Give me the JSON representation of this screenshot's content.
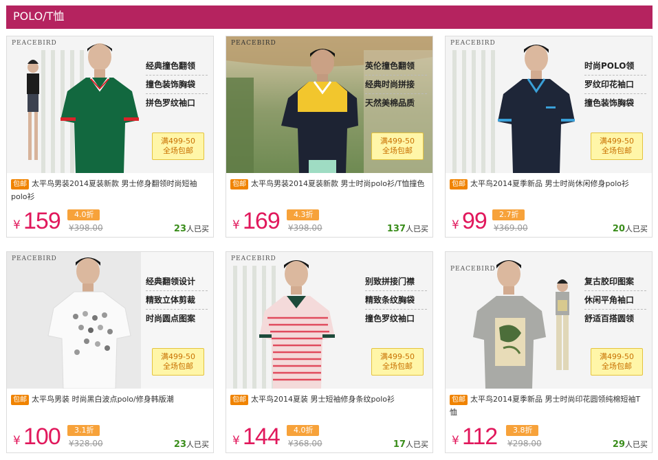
{
  "header": {
    "title": "POLO/T恤"
  },
  "products": [
    {
      "brand": "PEACEBIRD",
      "features": [
        "经典撞色翻领",
        "撞色装饰胸袋",
        "拼色罗纹袖口"
      ],
      "promo_line1": "满499-50",
      "promo_line2": "全场包邮",
      "tag": "包邮",
      "desc": "太平鸟男装2014夏装新款 男士修身翻领时尚短袖polo衫",
      "yen": "¥",
      "price": "159",
      "discount": "4.0折",
      "old_price": "¥398.00",
      "sold_count": "23",
      "sold_suffix": "人已买"
    },
    {
      "brand": "PEACEBIRD",
      "features": [
        "英伦撞色翻领",
        "经典时尚拼接",
        "天然美棉品质"
      ],
      "promo_line1": "满499-50",
      "promo_line2": "全场包邮",
      "tag": "包邮",
      "desc": "太平鸟男装2014夏装新款 男士时尚polo衫/T恤撞色",
      "yen": "¥",
      "price": "169",
      "discount": "4.3折",
      "old_price": "¥398.00",
      "sold_count": "137",
      "sold_suffix": "人已买"
    },
    {
      "brand": "PEACEBIRD",
      "features": [
        "时尚POLO领",
        "罗纹印花袖口",
        "撞色装饰胸袋"
      ],
      "promo_line1": "满499-50",
      "promo_line2": "全场包邮",
      "tag": "包邮",
      "desc": "太平鸟2014夏季新品 男士时尚休闲修身polo衫",
      "yen": "¥",
      "price": "99",
      "discount": "2.7折",
      "old_price": "¥369.00",
      "sold_count": "20",
      "sold_suffix": "人已买"
    },
    {
      "brand": "PEACEBIRD",
      "features": [
        "经典翻领设计",
        "精致立体剪裁",
        "时尚圆点图案"
      ],
      "promo_line1": "满499-50",
      "promo_line2": "全场包邮",
      "tag": "包邮",
      "desc": "太平鸟男装 时尚黑白波点polo/修身韩版潮",
      "yen": "¥",
      "price": "100",
      "discount": "3.1折",
      "old_price": "¥328.00",
      "sold_count": "23",
      "sold_suffix": "人已买"
    },
    {
      "brand": "PEACEBIRD",
      "features": [
        "别致拼接门襟",
        "精致条纹胸袋",
        "撞色罗纹袖口"
      ],
      "promo_line1": "满499-50",
      "promo_line2": "全场包邮",
      "tag": "包邮",
      "desc": "太平鸟2014夏装 男士短袖修身条纹polo衫",
      "yen": "¥",
      "price": "144",
      "discount": "4.0折",
      "old_price": "¥368.00",
      "sold_count": "17",
      "sold_suffix": "人已买"
    },
    {
      "brand": "PEACEBIRD",
      "features": [
        "复古胶印图案",
        "休闲平角袖口",
        "舒适百搭圆领"
      ],
      "promo_line1": "满499-50",
      "promo_line2": "全场包邮",
      "tag": "包邮",
      "desc": "太平鸟2014夏季新品 男士时尚印花圆领纯棉短袖T恤",
      "yen": "¥",
      "price": "112",
      "discount": "3.8折",
      "old_price": "¥298.00",
      "sold_count": "29",
      "sold_suffix": "人已买"
    }
  ],
  "colors": {
    "header_bg": "#b5235f",
    "price": "#e1185c",
    "discount_bg": "#f7a23a",
    "tag_bg": "#f08300",
    "sold_count": "#3a8d1b"
  }
}
